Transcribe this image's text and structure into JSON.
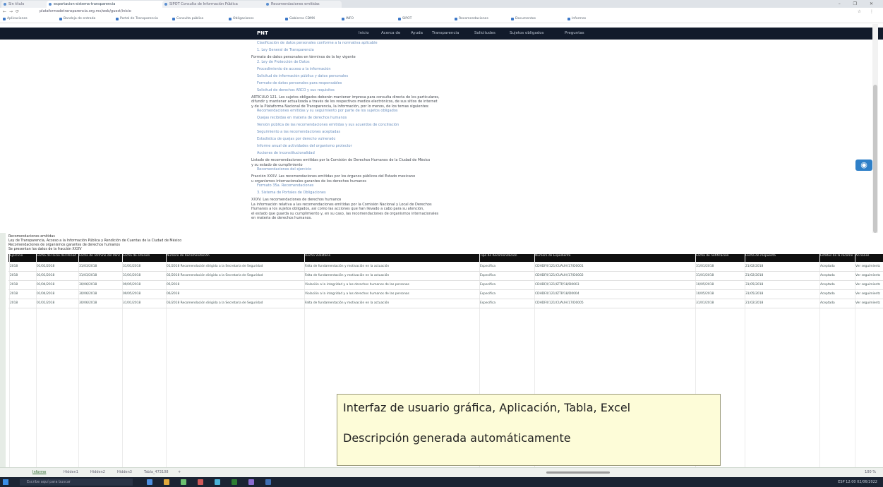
{
  "browser": {
    "tabs": [
      {
        "label": "Sin título"
      },
      {
        "label": "exportacion-sistema-transparencia"
      },
      {
        "label": "SIPOT Consulta de Información Pública"
      },
      {
        "label": "Recomendaciones emitidas"
      }
    ],
    "url": "plataformadetransparencia.org.mx/web/guest/inicio",
    "window_controls": "– ❐ ✕",
    "right_icons": "☆ ⋮"
  },
  "bookmarks": [
    "Aplicaciones",
    "Bandeja de entrada",
    "Portal de Transparencia",
    "Consulta pública",
    "Obligaciones",
    "Gobierno CDMX",
    "INFO",
    "SIPOT",
    "Recomendaciones",
    "Documentos",
    "Informes"
  ],
  "site_nav": {
    "logo": "PNT",
    "items": [
      "Inicio",
      "Acerca de",
      "Ayuda",
      "Transparencia",
      "Solicitudes",
      "Sujetos obligados",
      "Preguntas"
    ]
  },
  "doc": {
    "lines": [
      {
        "t": "link",
        "text": "Clasificación de datos personales conforme a la normativa aplicable"
      },
      {
        "t": "link",
        "text": "1. Ley General de Transparencia"
      },
      {
        "t": "para",
        "text": "Formato de datos personales en términos de la ley vigente"
      },
      {
        "t": "link",
        "text": "2. Ley de Protección de Datos"
      },
      {
        "t": "link",
        "text": "Procedimiento de acceso a la información"
      },
      {
        "t": "link",
        "text": "Solicitud de información pública y datos personales"
      },
      {
        "t": "link",
        "text": "Formato de datos personales para responsables"
      },
      {
        "t": "link",
        "text": "Solicitud de derechos ARCO y sus requisitos"
      },
      {
        "t": "para",
        "text": "ARTÍCULO 121. Los sujetos obligados deberán mantener impresa para consulta directa de los particulares,"
      },
      {
        "t": "para",
        "text": "difundir y mantener actualizada a través de los respectivos medios electrónicos, de sus sitios de internet"
      },
      {
        "t": "para",
        "text": "y de la Plataforma Nacional de Transparencia, la información, por lo menos, de los temas siguientes:"
      },
      {
        "t": "link",
        "text": "Recomendaciones emitidas y su seguimiento por parte de los sujetos obligados"
      },
      {
        "t": "link",
        "text": "Quejas recibidas en materia de derechos humanos"
      },
      {
        "t": "link",
        "text": "Versión pública de las recomendaciones emitidas y sus acuerdos de conciliación"
      },
      {
        "t": "link",
        "text": "Seguimiento a las recomendaciones aceptadas"
      },
      {
        "t": "link",
        "text": "Estadística de quejas por derecho vulnerado"
      },
      {
        "t": "link",
        "text": "Informe anual de actividades del organismo protector"
      },
      {
        "t": "link",
        "text": "Acciones de inconstitucionalidad"
      },
      {
        "t": "para",
        "text": "Listado de recomendaciones emitidas por la Comisión de Derechos Humanos de la Ciudad de México"
      },
      {
        "t": "para",
        "text": "y su estado de cumplimiento"
      },
      {
        "t": "link",
        "text": "Recomendaciones del ejercicio"
      },
      {
        "t": "para",
        "text": "Fracción XXXV. Las recomendaciones emitidas por los órganos públicos del Estado mexicano"
      },
      {
        "t": "para",
        "text": "u organismos internacionales garantes de los derechos humanos"
      },
      {
        "t": "link",
        "text": "Formato 35a. Recomendaciones"
      },
      {
        "t": "link",
        "text": "3. Sistema de Portales de Obligaciones"
      },
      {
        "t": "para",
        "text": "XXXV. Las recomendaciones de derechos humanos"
      },
      {
        "t": "para",
        "text": "La información relativa a las recomendaciones emitidas por la Comisión Nacional y Local de Derechos"
      },
      {
        "t": "para",
        "text": "Humanos a los sujetos obligados, así como las acciones que han llevado a cabo para su atención,"
      },
      {
        "t": "para",
        "text": "el estado que guarda su cumplimiento y, en su caso, las recomendaciones de organismos internacionales"
      },
      {
        "t": "para",
        "text": "en materia de derechos humanos."
      }
    ]
  },
  "side_button_icon": "eye-icon",
  "sheet": {
    "title_lines": [
      "Recomendaciones emitidas",
      "Ley de Transparencia, Acceso a la Información Pública y Rendición de Cuentas de la Ciudad de México",
      "Recomendaciones de organismos garantes de derechos humanos",
      "Se presentan los datos de la fracción XXXV"
    ],
    "columns": [
      "Ejercicio",
      "Fecha de Inicio del Periodo",
      "Fecha de Término del Periodo",
      "Fecha de emisión",
      "Número de Recomendación",
      "Hecho Violatorio",
      "Tipo de Recomendación",
      "Número de Expediente",
      "Fecha de notificación",
      "Fecha de respuesta",
      "Estatus de la recomendación",
      "Acciones"
    ],
    "rows": [
      [
        "2018",
        "01/01/2018",
        "31/03/2018",
        "31/01/2018",
        "01/2018 Recomendación dirigida a la Secretaría de Seguridad",
        "Falta de fundamentación y motivación en la actuación",
        "Específica",
        "CDHDF/I/121/CUAUH/17/D0001",
        "31/01/2018",
        "21/02/2018",
        "Aceptada",
        "Ver seguimiento"
      ],
      [
        "2018",
        "01/01/2018",
        "31/03/2018",
        "31/01/2018",
        "02/2018 Recomendación dirigida a la Secretaría de Seguridad",
        "Falta de fundamentación y motivación en la actuación",
        "Específica",
        "CDHDF/I/121/CUAUH/17/D0002",
        "31/01/2018",
        "21/02/2018",
        "Aceptada",
        "Ver seguimiento"
      ],
      [
        "2018",
        "01/04/2018",
        "30/06/2018",
        "09/05/2018",
        "05/2018",
        "Violación a la integridad y a los derechos humanos de las personas",
        "Específica",
        "CDHDF/I/121/IZTP/18/D0003",
        "10/05/2018",
        "31/05/2018",
        "Aceptada",
        "Ver seguimiento"
      ],
      [
        "2018",
        "01/04/2018",
        "30/06/2018",
        "09/05/2018",
        "06/2018",
        "Violación a la integridad y a los derechos humanos de las personas",
        "Específica",
        "CDHDF/I/121/IZTP/18/D0004",
        "10/05/2018",
        "31/05/2018",
        "Aceptada",
        "Ver seguimiento"
      ],
      [
        "2018",
        "01/01/2018",
        "30/06/2018",
        "31/01/2018",
        "03/2018 Recomendación dirigida a la Secretaría de Seguridad",
        "Falta de fundamentación y motivación en la actuación",
        "Específica",
        "CDHDF/I/121/CUAUH/17/D0005",
        "31/01/2018",
        "21/02/2018",
        "Aceptada",
        "Ver seguimiento"
      ]
    ]
  },
  "caption": {
    "line1": "Interfaz de usuario gráfica, Aplicación, Tabla, Excel",
    "line2": "Descripción generada automáticamente"
  },
  "sheet_tabs": [
    "Informe",
    "Hidden1",
    "Hidden2",
    "Hidden3",
    "Tabla_473108",
    "+"
  ],
  "zoom": "100 %",
  "taskbar": {
    "search_placeholder": "Escribe aquí para buscar",
    "tray_text": "ESP  12:00  02/06/2022",
    "icon_colors": [
      "#4d8fe0",
      "#e0a83c",
      "#6cc070",
      "#d05a5a",
      "#4ab3d8",
      "#2e7d32",
      "#8a6cd0",
      "#3f6fb3"
    ]
  }
}
